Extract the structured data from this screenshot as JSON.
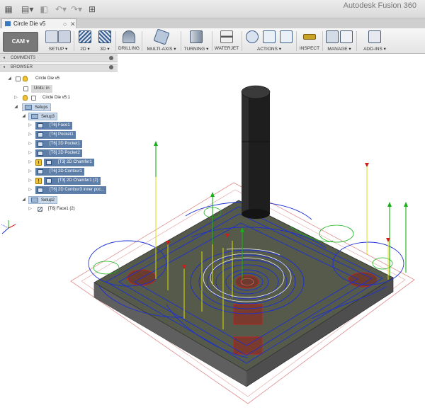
{
  "app": {
    "title": "Autodesk Fusion 360"
  },
  "document_tab": {
    "label": "Circle Die v5"
  },
  "workspace": {
    "label": "CAM ▾"
  },
  "ribbon_groups": [
    {
      "label": "SETUP ▾"
    },
    {
      "label": "2D ▾"
    },
    {
      "label": "3D ▾"
    },
    {
      "label": "DRILLING"
    },
    {
      "label": "MULTI-AXIS ▾"
    },
    {
      "label": "TURNING ▾"
    },
    {
      "label": "WATERJET"
    },
    {
      "label": "ACTIONS ▾"
    },
    {
      "label": "INSPECT"
    },
    {
      "label": "MANAGE ▾"
    },
    {
      "label": "ADD-INS ▾"
    }
  ],
  "panels": {
    "comments": "COMMENTS",
    "browser": "BROWSER"
  },
  "tree": {
    "root": "Circle Die v5",
    "units": "Units: in",
    "component": "Circle Die v5:1",
    "setups": "Setups",
    "setup1": "Setup3",
    "setup2": "Setup2",
    "operations": [
      {
        "label": "[T6] Face1",
        "warning": false
      },
      {
        "label": "[T6] Pocket1",
        "warning": false
      },
      {
        "label": "[T6] 2D Pocket1",
        "warning": false
      },
      {
        "label": "[T6] 2D Pocket2",
        "warning": false
      },
      {
        "label": "[T3] 2D Chamfer1",
        "warning": true
      },
      {
        "label": "[T6] 2D Contour1",
        "warning": false
      },
      {
        "label": "[T3] 2D Chamfer1 (2)",
        "warning": true
      },
      {
        "label": "[T6] 2D Contour3 inner poc...",
        "warning": false
      }
    ],
    "setup2_operation": "[T6] Face1 (2)"
  },
  "colors": {
    "selection": "#5c7ea8",
    "toolpath_blue": "#1a2fd6",
    "toolpath_red": "#d11a1a",
    "plunge_yellow": "#e0e000",
    "retract_green": "#18b018",
    "stock_body": "#5a5a5a"
  }
}
